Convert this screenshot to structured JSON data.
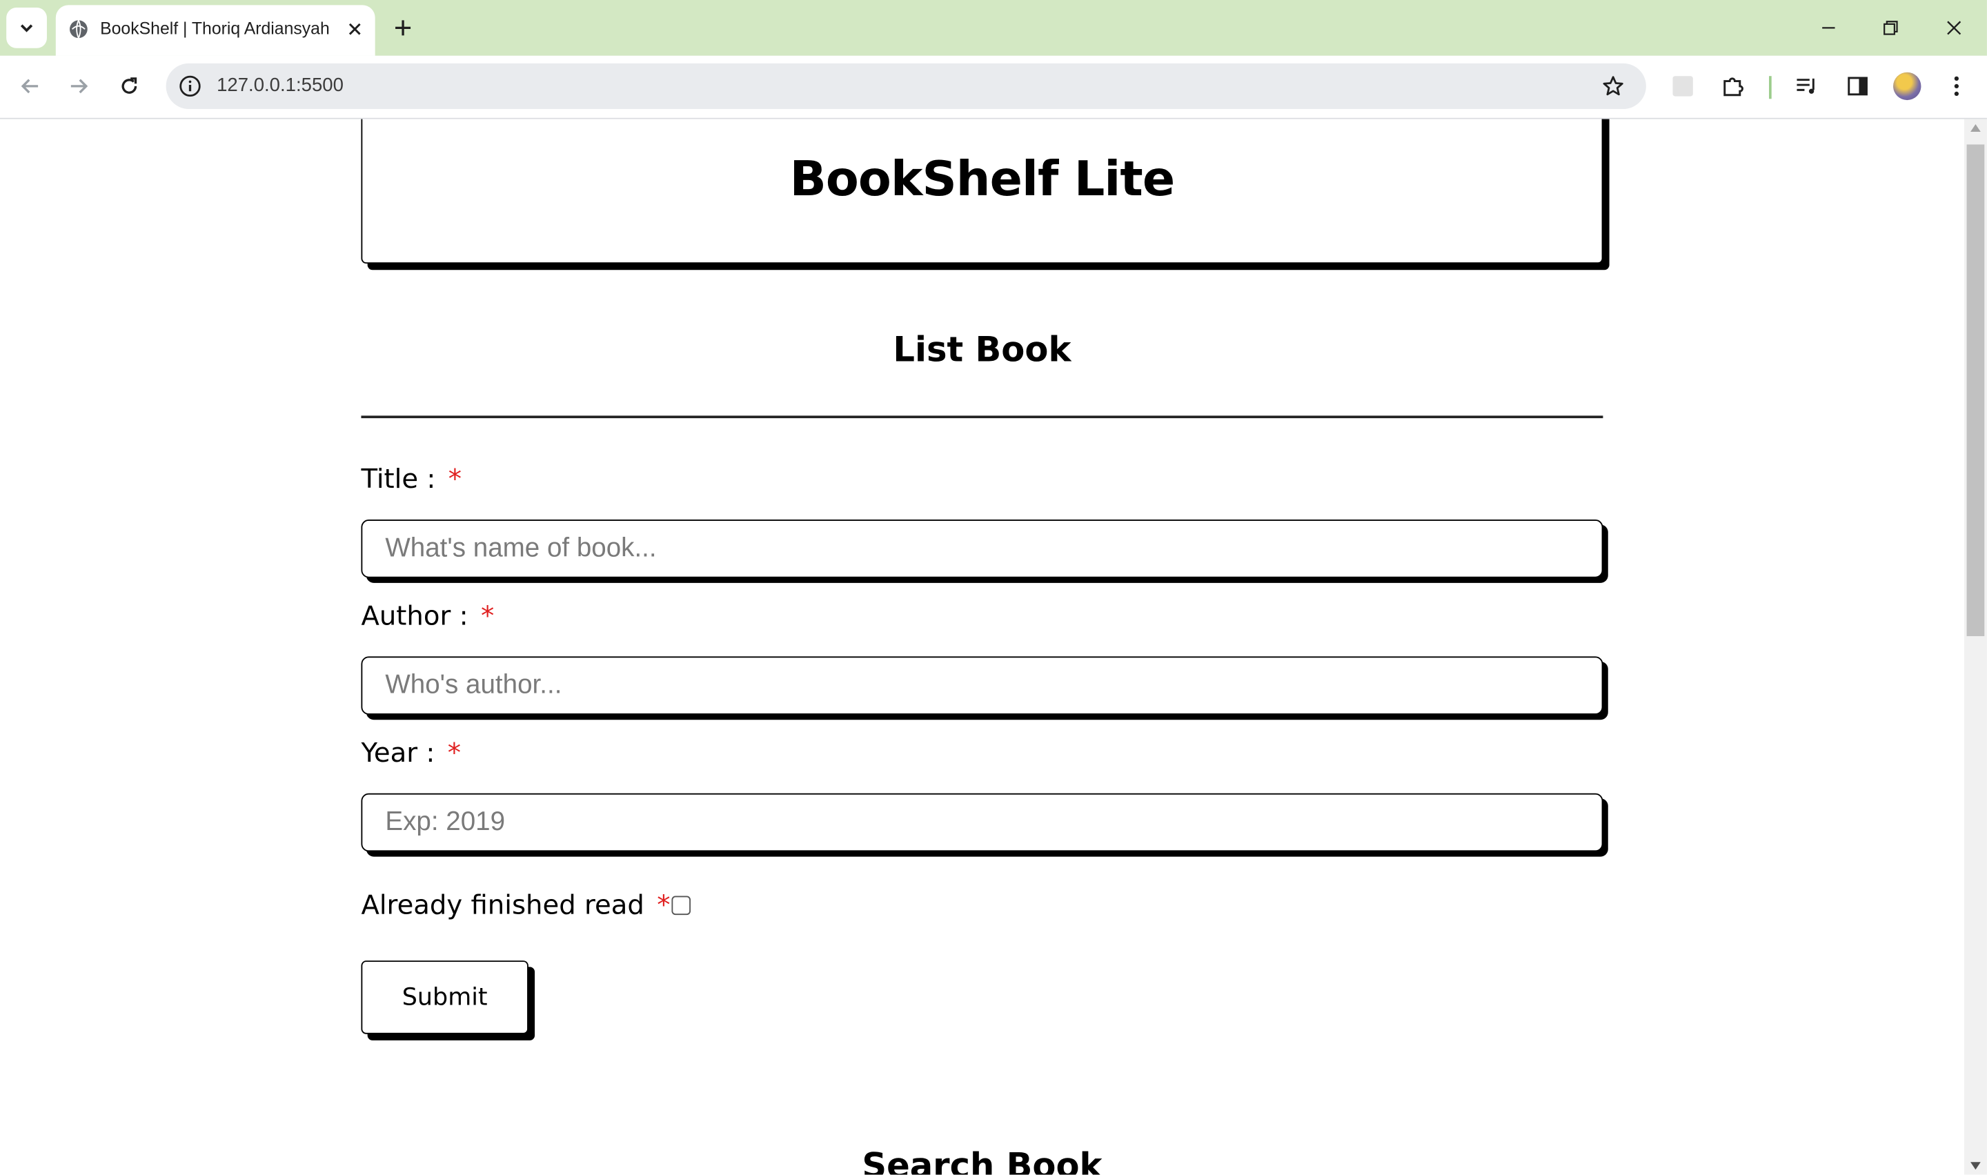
{
  "browser": {
    "tab_title": "BookShelf | Thoriq Ardiansyah",
    "url": "127.0.0.1:5500"
  },
  "header": {
    "title": "BookShelf Lite"
  },
  "form": {
    "section_title": "List Book",
    "required_mark": "*",
    "title_label": "Title :",
    "title_placeholder": "What's name of book...",
    "author_label": "Author :",
    "author_placeholder": "Who's author...",
    "year_label": "Year :",
    "year_placeholder": "Exp: 2019",
    "finished_label": "Already finished read",
    "finished_checked": false,
    "submit_label": "Submit"
  },
  "search": {
    "section_title": "Search Book"
  },
  "colors": {
    "tabstrip": "#d3e8c3",
    "required": "#e02020",
    "border": "#000000"
  },
  "icons": {
    "tab_favicon": "globe-icon",
    "omnibox": "info-icon",
    "bookmark": "star-icon",
    "extensions": "puzzle-icon",
    "media": "media-controls-icon",
    "side_panel": "side-panel-icon",
    "menu": "kebab-menu-icon"
  }
}
